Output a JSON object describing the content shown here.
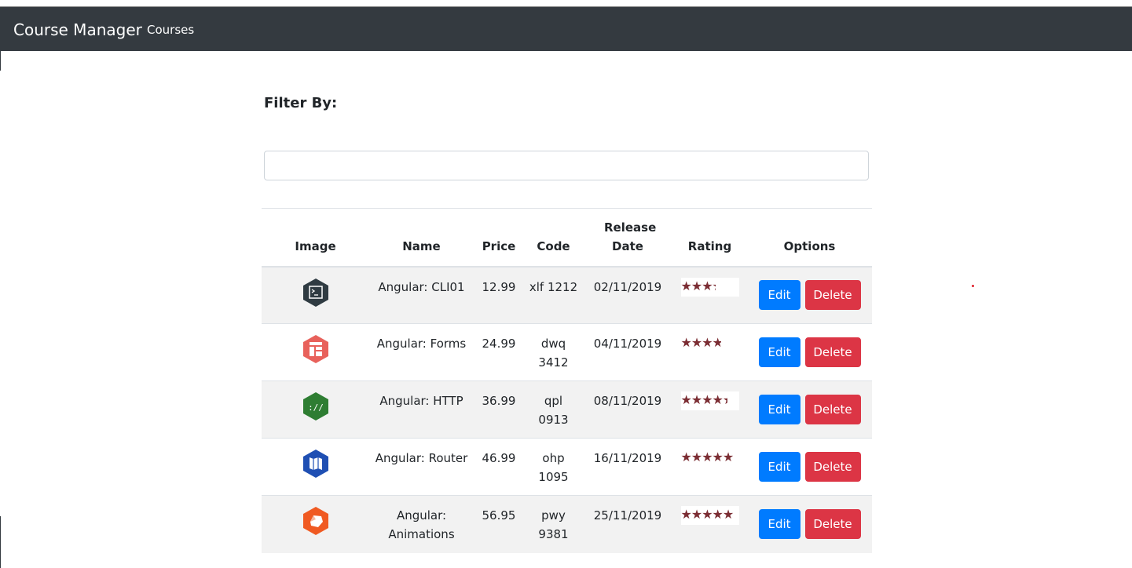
{
  "navbar": {
    "brand": "Course Manager",
    "link": "Courses",
    "bg_color": "#343a40"
  },
  "filter": {
    "title": "Filter By:",
    "value": "",
    "placeholder": ""
  },
  "table": {
    "headers": [
      "Image",
      "Name",
      "Price",
      "Code",
      "Release Date",
      "Rating",
      "Options"
    ],
    "rows": [
      {
        "icon": "angular-cli-icon",
        "icon_color": "#2f3b42",
        "name": "Angular: CLI01",
        "price": "12.99",
        "code": "xlf 1212",
        "release_date": "02/11/2019",
        "rating": 3,
        "edit": "Edit",
        "delete": "Delete"
      },
      {
        "icon": "angular-forms-icon",
        "icon_color": "#e8615b",
        "name": "Angular: Forms",
        "price": "24.99",
        "code": "dwq 3412",
        "release_date": "04/11/2019",
        "rating": 3.5,
        "edit": "Edit",
        "delete": "Delete"
      },
      {
        "icon": "angular-http-icon",
        "icon_color": "#2e7d32",
        "name": "Angular: HTTP",
        "price": "36.99",
        "code": "qpl 0913",
        "release_date": "08/11/2019",
        "rating": 4,
        "edit": "Edit",
        "delete": "Delete"
      },
      {
        "icon": "angular-router-icon",
        "icon_color": "#1f4fb3",
        "name": "Angular: Router",
        "price": "46.99",
        "code": "ohp 1095",
        "release_date": "16/11/2019",
        "rating": 4.5,
        "edit": "Edit",
        "delete": "Delete"
      },
      {
        "icon": "angular-animations-icon",
        "icon_color": "#f05a22",
        "name": "Angular: Animations",
        "price": "56.95",
        "code": "pwy 9381",
        "release_date": "25/11/2019",
        "rating": 5,
        "edit": "Edit",
        "delete": "Delete"
      }
    ]
  },
  "colors": {
    "edit_button": "#007bff",
    "delete_button": "#dc3545",
    "star": "#7b2d33"
  }
}
